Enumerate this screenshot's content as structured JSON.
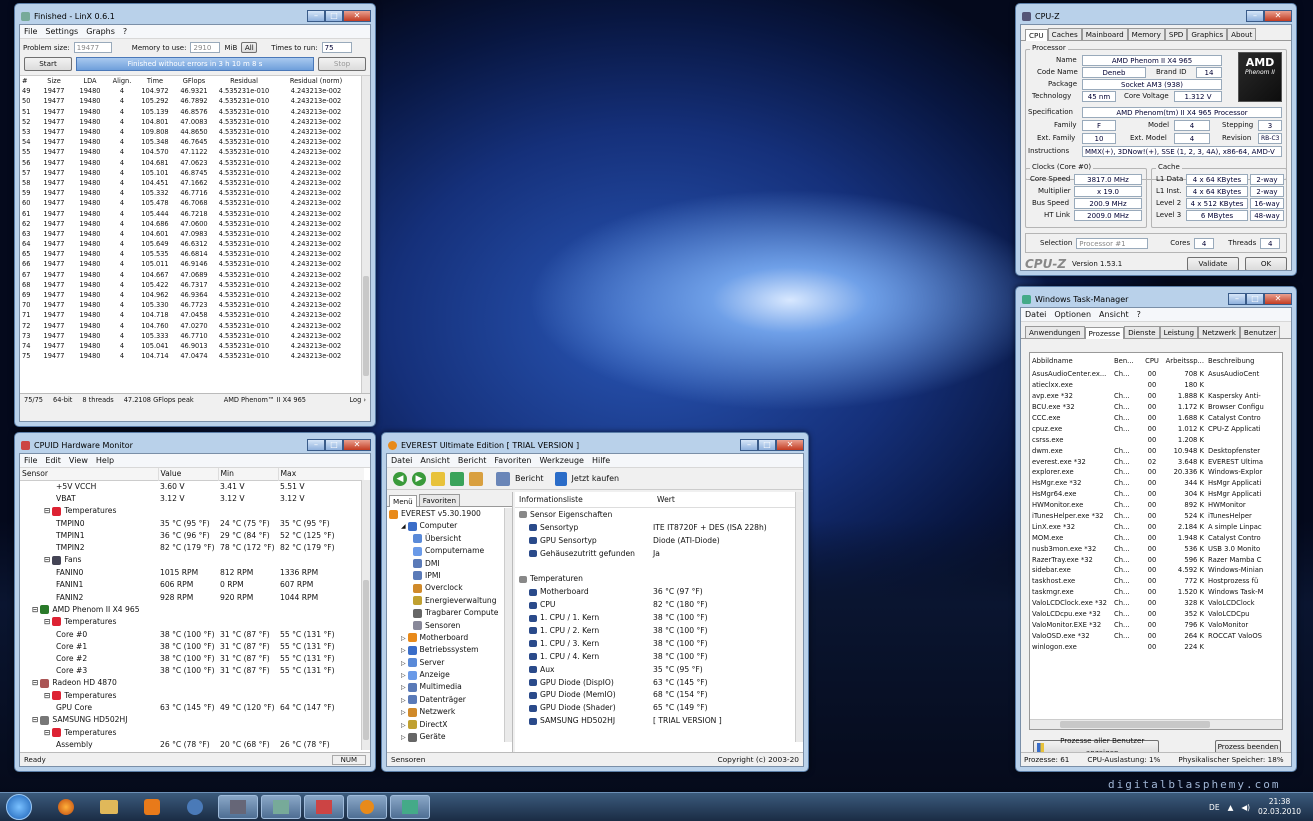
{
  "linx": {
    "title": "Finished - LinX 0.6.1",
    "menu": [
      "File",
      "Settings",
      "Graphs",
      "?"
    ],
    "problem_size_label": "Problem size:",
    "problem_size": "19477",
    "memory_label": "Memory to use:",
    "memory": "2910",
    "mib": "MiB",
    "all": "All",
    "times_label": "Times to run:",
    "times": "75",
    "start": "Start",
    "status": "Finished without errors in 3 h 10 m 8 s",
    "stop": "Stop",
    "headers": [
      "#",
      "Size",
      "LDA",
      "Align.",
      "Time",
      "GFlops",
      "Residual",
      "Residual (norm)"
    ],
    "rows": [
      [
        "49",
        "19477",
        "19480",
        "4",
        "104.972",
        "46.9321",
        "4.535231e-010",
        "4.243213e-002"
      ],
      [
        "50",
        "19477",
        "19480",
        "4",
        "105.292",
        "46.7892",
        "4.535231e-010",
        "4.243213e-002"
      ],
      [
        "51",
        "19477",
        "19480",
        "4",
        "105.139",
        "46.8576",
        "4.535231e-010",
        "4.243213e-002"
      ],
      [
        "52",
        "19477",
        "19480",
        "4",
        "104.801",
        "47.0083",
        "4.535231e-010",
        "4.243213e-002"
      ],
      [
        "53",
        "19477",
        "19480",
        "4",
        "109.808",
        "44.8650",
        "4.535231e-010",
        "4.243213e-002"
      ],
      [
        "54",
        "19477",
        "19480",
        "4",
        "105.348",
        "46.7645",
        "4.535231e-010",
        "4.243213e-002"
      ],
      [
        "55",
        "19477",
        "19480",
        "4",
        "104.570",
        "47.1122",
        "4.535231e-010",
        "4.243213e-002"
      ],
      [
        "56",
        "19477",
        "19480",
        "4",
        "104.681",
        "47.0623",
        "4.535231e-010",
        "4.243213e-002"
      ],
      [
        "57",
        "19477",
        "19480",
        "4",
        "105.101",
        "46.8745",
        "4.535231e-010",
        "4.243213e-002"
      ],
      [
        "58",
        "19477",
        "19480",
        "4",
        "104.451",
        "47.1662",
        "4.535231e-010",
        "4.243213e-002"
      ],
      [
        "59",
        "19477",
        "19480",
        "4",
        "105.332",
        "46.7716",
        "4.535231e-010",
        "4.243213e-002"
      ],
      [
        "60",
        "19477",
        "19480",
        "4",
        "105.478",
        "46.7068",
        "4.535231e-010",
        "4.243213e-002"
      ],
      [
        "61",
        "19477",
        "19480",
        "4",
        "105.444",
        "46.7218",
        "4.535231e-010",
        "4.243213e-002"
      ],
      [
        "62",
        "19477",
        "19480",
        "4",
        "104.686",
        "47.0600",
        "4.535231e-010",
        "4.243213e-002"
      ],
      [
        "63",
        "19477",
        "19480",
        "4",
        "104.601",
        "47.0983",
        "4.535231e-010",
        "4.243213e-002"
      ],
      [
        "64",
        "19477",
        "19480",
        "4",
        "105.649",
        "46.6312",
        "4.535231e-010",
        "4.243213e-002"
      ],
      [
        "65",
        "19477",
        "19480",
        "4",
        "105.535",
        "46.6814",
        "4.535231e-010",
        "4.243213e-002"
      ],
      [
        "66",
        "19477",
        "19480",
        "4",
        "105.011",
        "46.9146",
        "4.535231e-010",
        "4.243213e-002"
      ],
      [
        "67",
        "19477",
        "19480",
        "4",
        "104.667",
        "47.0689",
        "4.535231e-010",
        "4.243213e-002"
      ],
      [
        "68",
        "19477",
        "19480",
        "4",
        "105.422",
        "46.7317",
        "4.535231e-010",
        "4.243213e-002"
      ],
      [
        "69",
        "19477",
        "19480",
        "4",
        "104.962",
        "46.9364",
        "4.535231e-010",
        "4.243213e-002"
      ],
      [
        "70",
        "19477",
        "19480",
        "4",
        "105.330",
        "46.7723",
        "4.535231e-010",
        "4.243213e-002"
      ],
      [
        "71",
        "19477",
        "19480",
        "4",
        "104.718",
        "47.0458",
        "4.535231e-010",
        "4.243213e-002"
      ],
      [
        "72",
        "19477",
        "19480",
        "4",
        "104.760",
        "47.0270",
        "4.535231e-010",
        "4.243213e-002"
      ],
      [
        "73",
        "19477",
        "19480",
        "4",
        "105.333",
        "46.7710",
        "4.535231e-010",
        "4.243213e-002"
      ],
      [
        "74",
        "19477",
        "19480",
        "4",
        "105.041",
        "46.9013",
        "4.535231e-010",
        "4.243213e-002"
      ],
      [
        "75",
        "19477",
        "19480",
        "4",
        "104.714",
        "47.0474",
        "4.535231e-010",
        "4.243213e-002"
      ]
    ],
    "status_bar": [
      "75/75",
      "64-bit",
      "8 threads",
      "47.2108 GFlops peak",
      "AMD Phenom™ II X4 965",
      "Log ›"
    ]
  },
  "hwmon": {
    "title": "CPUID Hardware Monitor",
    "menu": [
      "File",
      "Edit",
      "View",
      "Help"
    ],
    "headers": [
      "Sensor",
      "Value",
      "Min",
      "Max"
    ],
    "rows": [
      {
        "indent": 3,
        "icon": "",
        "label": "+5V VCCH",
        "v": "3.60 V",
        "mn": "3.41 V",
        "mx": "5.51 V"
      },
      {
        "indent": 3,
        "icon": "",
        "label": "VBAT",
        "v": "3.12 V",
        "mn": "3.12 V",
        "mx": "3.12 V"
      },
      {
        "indent": 2,
        "icon": "temp",
        "label": "Temperatures",
        "v": "",
        "mn": "",
        "mx": ""
      },
      {
        "indent": 3,
        "icon": "",
        "label": "TMPIN0",
        "v": "35 °C  (95 °F)",
        "mn": "24 °C  (75 °F)",
        "mx": "35 °C  (95 °F)"
      },
      {
        "indent": 3,
        "icon": "",
        "label": "TMPIN1",
        "v": "36 °C  (96 °F)",
        "mn": "29 °C  (84 °F)",
        "mx": "52 °C  (125 °F)"
      },
      {
        "indent": 3,
        "icon": "",
        "label": "TMPIN2",
        "v": "82 °C  (179 °F)",
        "mn": "78 °C  (172 °F)",
        "mx": "82 °C  (179 °F)"
      },
      {
        "indent": 2,
        "icon": "fan",
        "label": "Fans",
        "v": "",
        "mn": "",
        "mx": ""
      },
      {
        "indent": 3,
        "icon": "",
        "label": "FANIN0",
        "v": "1015 RPM",
        "mn": "812 RPM",
        "mx": "1336 RPM"
      },
      {
        "indent": 3,
        "icon": "",
        "label": "FANIN1",
        "v": "606 RPM",
        "mn": "0 RPM",
        "mx": "607 RPM"
      },
      {
        "indent": 3,
        "icon": "",
        "label": "FANIN2",
        "v": "928 RPM",
        "mn": "920 RPM",
        "mx": "1044 RPM"
      },
      {
        "indent": 1,
        "icon": "cpu",
        "label": "AMD Phenom II X4 965",
        "v": "",
        "mn": "",
        "mx": ""
      },
      {
        "indent": 2,
        "icon": "temp",
        "label": "Temperatures",
        "v": "",
        "mn": "",
        "mx": ""
      },
      {
        "indent": 3,
        "icon": "",
        "label": "Core #0",
        "v": "38 °C  (100 °F)",
        "mn": "31 °C  (87 °F)",
        "mx": "55 °C  (131 °F)"
      },
      {
        "indent": 3,
        "icon": "",
        "label": "Core #1",
        "v": "38 °C  (100 °F)",
        "mn": "31 °C  (87 °F)",
        "mx": "55 °C  (131 °F)"
      },
      {
        "indent": 3,
        "icon": "",
        "label": "Core #2",
        "v": "38 °C  (100 °F)",
        "mn": "31 °C  (87 °F)",
        "mx": "55 °C  (131 °F)"
      },
      {
        "indent": 3,
        "icon": "",
        "label": "Core #3",
        "v": "38 °C  (100 °F)",
        "mn": "31 °C  (87 °F)",
        "mx": "55 °C  (131 °F)"
      },
      {
        "indent": 1,
        "icon": "gpu",
        "label": "Radeon HD 4870",
        "v": "",
        "mn": "",
        "mx": ""
      },
      {
        "indent": 2,
        "icon": "temp",
        "label": "Temperatures",
        "v": "",
        "mn": "",
        "mx": ""
      },
      {
        "indent": 3,
        "icon": "",
        "label": "GPU Core",
        "v": "63 °C  (145 °F)",
        "mn": "49 °C  (120 °F)",
        "mx": "64 °C  (147 °F)"
      },
      {
        "indent": 1,
        "icon": "hdd",
        "label": "SAMSUNG HD502HJ",
        "v": "",
        "mn": "",
        "mx": ""
      },
      {
        "indent": 2,
        "icon": "temp",
        "label": "Temperatures",
        "v": "",
        "mn": "",
        "mx": ""
      },
      {
        "indent": 3,
        "icon": "",
        "label": "Assembly",
        "v": "26 °C  (78 °F)",
        "mn": "20 °C  (68 °F)",
        "mx": "26 °C  (78 °F)"
      }
    ],
    "status": "Ready",
    "num": "NUM"
  },
  "everest": {
    "title": "EVEREST Ultimate Edition  [ TRIAL VERSION ]",
    "menu": [
      "Datei",
      "Ansicht",
      "Bericht",
      "Favoriten",
      "Werkzeuge",
      "Hilfe"
    ],
    "toolbar": {
      "report": "Bericht",
      "buy": "Jetzt kaufen"
    },
    "tabs": [
      "Menü",
      "Favoriten"
    ],
    "tree": [
      {
        "i": 0,
        "t": "EVEREST v5.30.1900"
      },
      {
        "i": 1,
        "t": "Computer"
      },
      {
        "i": 2,
        "t": "Übersicht"
      },
      {
        "i": 2,
        "t": "Computername"
      },
      {
        "i": 2,
        "t": "DMI"
      },
      {
        "i": 2,
        "t": "IPMI"
      },
      {
        "i": 2,
        "t": "Overclock"
      },
      {
        "i": 2,
        "t": "Energieverwaltung"
      },
      {
        "i": 2,
        "t": "Tragbarer Compute"
      },
      {
        "i": 2,
        "t": "Sensoren"
      },
      {
        "i": 1,
        "t": "Motherboard"
      },
      {
        "i": 1,
        "t": "Betriebssystem"
      },
      {
        "i": 1,
        "t": "Server"
      },
      {
        "i": 1,
        "t": "Anzeige"
      },
      {
        "i": 1,
        "t": "Multimedia"
      },
      {
        "i": 1,
        "t": "Datenträger"
      },
      {
        "i": 1,
        "t": "Netzwerk"
      },
      {
        "i": 1,
        "t": "DirectX"
      },
      {
        "i": 1,
        "t": "Geräte"
      }
    ],
    "col_headers": [
      "Informationsliste",
      "Wert"
    ],
    "items": [
      {
        "indent": 0,
        "label": "Sensor Eigenschaften",
        "value": ""
      },
      {
        "indent": 1,
        "label": "Sensortyp",
        "value": "ITE IT8720F + DES  (ISA 228h)"
      },
      {
        "indent": 1,
        "label": "GPU Sensortyp",
        "value": "Diode  (ATI-Diode)"
      },
      {
        "indent": 1,
        "label": "Gehäusezutritt gefunden",
        "value": "Ja"
      },
      {
        "indent": 0,
        "label": "",
        "value": ""
      },
      {
        "indent": 0,
        "label": "Temperaturen",
        "value": ""
      },
      {
        "indent": 1,
        "label": "Motherboard",
        "value": "36 °C  (97 °F)"
      },
      {
        "indent": 1,
        "label": "CPU",
        "value": "82 °C  (180 °F)"
      },
      {
        "indent": 1,
        "label": "1. CPU / 1. Kern",
        "value": "38 °C  (100 °F)"
      },
      {
        "indent": 1,
        "label": "1. CPU / 2. Kern",
        "value": "38 °C  (100 °F)"
      },
      {
        "indent": 1,
        "label": "1. CPU / 3. Kern",
        "value": "38 °C  (100 °F)"
      },
      {
        "indent": 1,
        "label": "1. CPU / 4. Kern",
        "value": "38 °C  (100 °F)"
      },
      {
        "indent": 1,
        "label": "Aux",
        "value": "35 °C  (95 °F)"
      },
      {
        "indent": 1,
        "label": "GPU Diode (DispIO)",
        "value": "63 °C  (145 °F)"
      },
      {
        "indent": 1,
        "label": "GPU Diode (MemIO)",
        "value": "68 °C  (154 °F)"
      },
      {
        "indent": 1,
        "label": "GPU Diode (Shader)",
        "value": "65 °C  (149 °F)"
      },
      {
        "indent": 1,
        "label": "SAMSUNG HD502HJ",
        "value": "[ TRIAL VERSION ]"
      }
    ],
    "status_left": "Sensoren",
    "status_right": "Copyright (c) 2003-20"
  },
  "cpuz": {
    "title": "CPU-Z",
    "tabs": [
      "CPU",
      "Caches",
      "Mainboard",
      "Memory",
      "SPD",
      "Graphics",
      "About"
    ],
    "processor": "Processor",
    "name_l": "Name",
    "name": "AMD Phenom II X4 965",
    "code_l": "Code Name",
    "code": "Deneb",
    "brand_l": "Brand ID",
    "brand": "14",
    "pkg_l": "Package",
    "pkg": "Socket AM3 (938)",
    "tech_l": "Technology",
    "tech": "45 nm",
    "cv_l": "Core Voltage",
    "cv": "1.312 V",
    "spec_l": "Specification",
    "spec": "AMD Phenom(tm) II X4 965 Processor",
    "fam_l": "Family",
    "fam": "F",
    "model_l": "Model",
    "model": "4",
    "step_l": "Stepping",
    "step": "3",
    "efam_l": "Ext. Family",
    "efam": "10",
    "emodel_l": "Ext. Model",
    "emodel": "4",
    "rev_l": "Revision",
    "rev": "RB-C3",
    "inst_l": "Instructions",
    "inst": "MMX(+), 3DNow!(+), SSE (1, 2, 3, 4A), x86-64, AMD-V",
    "clocks": "Clocks (Core #0)",
    "cache": "Cache",
    "cs_l": "Core Speed",
    "cs": "3817.0 MHz",
    "mul_l": "Multiplier",
    "mul": "x 19.0",
    "bus_l": "Bus Speed",
    "bus": "200.9 MHz",
    "ht_l": "HT Link",
    "ht": "2009.0 MHz",
    "l1d_l": "L1 Data",
    "l1d": "4 x 64 KBytes",
    "l1d_w": "2-way",
    "l1i_l": "L1 Inst.",
    "l1i": "4 x 64 KBytes",
    "l1i_w": "2-way",
    "l2_l": "Level 2",
    "l2": "4 x 512 KBytes",
    "l2_w": "16-way",
    "l3_l": "Level 3",
    "l3": "6 MBytes",
    "l3_w": "48-way",
    "sel_l": "Selection",
    "sel": "Processor #1",
    "cores_l": "Cores",
    "cores": "4",
    "thr_l": "Threads",
    "thr": "4",
    "logo": "CPU-Z",
    "version": "Version 1.53.1",
    "validate": "Validate",
    "ok": "OK",
    "amd_logo": "AMD",
    "amd_sub": "Phenom II"
  },
  "taskmgr": {
    "title": "Windows Task-Manager",
    "menu": [
      "Datei",
      "Optionen",
      "Ansicht",
      "?"
    ],
    "tabs": [
      "Anwendungen",
      "Prozesse",
      "Dienste",
      "Leistung",
      "Netzwerk",
      "Benutzer"
    ],
    "headers": [
      "Abbildname",
      "Ben...",
      "CPU",
      "Arbeitssp...",
      "Beschreibung"
    ],
    "rows": [
      [
        "AsusAudioCenter.ex...",
        "Ch...",
        "00",
        "708 K",
        "AsusAudioCent"
      ],
      [
        "atieclxx.exe",
        "",
        "00",
        "180 K",
        ""
      ],
      [
        "avp.exe *32",
        "Ch...",
        "00",
        "1.888 K",
        "Kaspersky Anti-"
      ],
      [
        "BCU.exe *32",
        "Ch...",
        "00",
        "1.172 K",
        "Browser Configu"
      ],
      [
        "CCC.exe",
        "Ch...",
        "00",
        "1.688 K",
        "Catalyst Contro"
      ],
      [
        "cpuz.exe",
        "Ch...",
        "00",
        "1.012 K",
        "CPU-Z Applicati"
      ],
      [
        "csrss.exe",
        "",
        "00",
        "1.208 K",
        ""
      ],
      [
        "dwm.exe",
        "Ch...",
        "00",
        "10.948 K",
        "Desktopfenster"
      ],
      [
        "everest.exe *32",
        "Ch...",
        "02",
        "3.648 K",
        "EVEREST Ultima"
      ],
      [
        "explorer.exe",
        "Ch...",
        "00",
        "20.336 K",
        "Windows-Explor"
      ],
      [
        "HsMgr.exe *32",
        "Ch...",
        "00",
        "344 K",
        "HsMgr Applicati"
      ],
      [
        "HsMgr64.exe",
        "Ch...",
        "00",
        "304 K",
        "HsMgr Applicati"
      ],
      [
        "HWMonitor.exe",
        "Ch...",
        "00",
        "892 K",
        "HWMonitor"
      ],
      [
        "iTunesHelper.exe *32",
        "Ch...",
        "00",
        "524 K",
        "iTunesHelper"
      ],
      [
        "LinX.exe *32",
        "Ch...",
        "00",
        "2.184 K",
        "A simple Linpac"
      ],
      [
        "MOM.exe",
        "Ch...",
        "00",
        "1.948 K",
        "Catalyst Contro"
      ],
      [
        "nusb3mon.exe *32",
        "Ch...",
        "00",
        "536 K",
        "USB 3.0 Monito"
      ],
      [
        "RazerTray.exe *32",
        "Ch...",
        "00",
        "596 K",
        "Razer Mamba C"
      ],
      [
        "sidebar.exe",
        "Ch...",
        "00",
        "4.592 K",
        "Windows-Minian"
      ],
      [
        "taskhost.exe",
        "Ch...",
        "00",
        "772 K",
        "Hostprozess fü"
      ],
      [
        "taskmgr.exe",
        "Ch...",
        "00",
        "1.520 K",
        "Windows Task-M"
      ],
      [
        "ValoLCDClock.exe *32",
        "Ch...",
        "00",
        "328 K",
        "ValoLCDClock"
      ],
      [
        "ValoLCDcpu.exe *32",
        "Ch...",
        "00",
        "352 K",
        "ValoLCDCpu"
      ],
      [
        "ValoMonitor.EXE *32",
        "Ch...",
        "00",
        "796 K",
        "ValoMonitor"
      ],
      [
        "ValoOSD.exe *32",
        "Ch...",
        "00",
        "264 K",
        "ROCCAT ValoOS"
      ],
      [
        "winlogon.exe",
        "",
        "00",
        "224 K",
        ""
      ]
    ],
    "all_users": "Prozesse aller Benutzer anzeigen",
    "end": "Prozess beenden",
    "status": [
      "Prozesse: 61",
      "CPU-Auslastung: 1%",
      "Physikalischer Speicher: 18%"
    ]
  },
  "watermark": "digitalblasphemy.com",
  "tray": {
    "lang": "DE",
    "time": "21:38",
    "date": "02.03.2010"
  }
}
